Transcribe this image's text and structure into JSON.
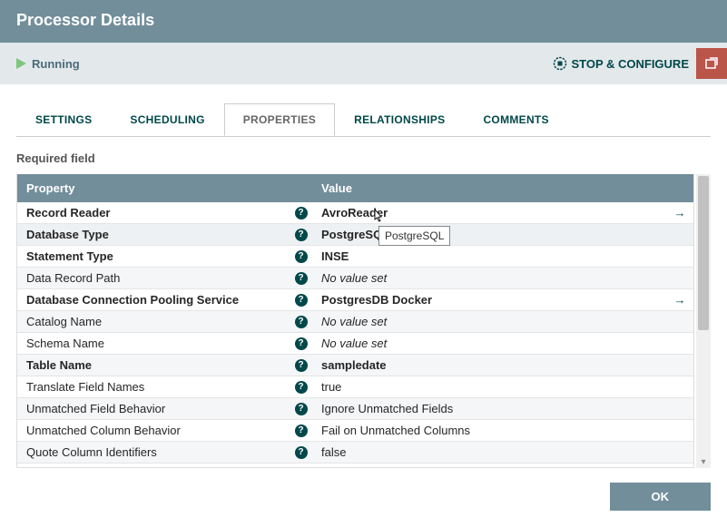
{
  "header": {
    "title": "Processor Details"
  },
  "status": {
    "state": "Running",
    "stop_label": "STOP & CONFIGURE"
  },
  "tabs": {
    "items": [
      {
        "label": "SETTINGS"
      },
      {
        "label": "SCHEDULING"
      },
      {
        "label": "PROPERTIES"
      },
      {
        "label": "RELATIONSHIPS"
      },
      {
        "label": "COMMENTS"
      }
    ],
    "active_index": 2
  },
  "required_label": "Required field",
  "columns": {
    "property": "Property",
    "value": "Value"
  },
  "properties": [
    {
      "name": "Record Reader",
      "bold": true,
      "value": "AvroReader",
      "has_arrow": true
    },
    {
      "name": "Database Type",
      "bold": true,
      "value": "PostgreSQL",
      "selected": true
    },
    {
      "name": "Statement Type",
      "bold": true,
      "value": "INSE",
      "partial": true
    },
    {
      "name": "Data Record Path",
      "bold": false,
      "value": "No value set",
      "no_value": true
    },
    {
      "name": "Database Connection Pooling Service",
      "bold": true,
      "value": "PostgresDB Docker",
      "has_arrow": true
    },
    {
      "name": "Catalog Name",
      "bold": false,
      "value": "No value set",
      "no_value": true
    },
    {
      "name": "Schema Name",
      "bold": false,
      "value": "No value set",
      "no_value": true
    },
    {
      "name": "Table Name",
      "bold": true,
      "value": "sampledate"
    },
    {
      "name": "Translate Field Names",
      "bold": false,
      "value": "true"
    },
    {
      "name": "Unmatched Field Behavior",
      "bold": false,
      "value": "Ignore Unmatched Fields"
    },
    {
      "name": "Unmatched Column Behavior",
      "bold": false,
      "value": "Fail on Unmatched Columns"
    },
    {
      "name": "Quote Column Identifiers",
      "bold": false,
      "value": "false"
    }
  ],
  "tooltip": {
    "text": "PostgreSQL"
  },
  "footer": {
    "ok": "OK"
  },
  "icons": {
    "help": "?"
  }
}
